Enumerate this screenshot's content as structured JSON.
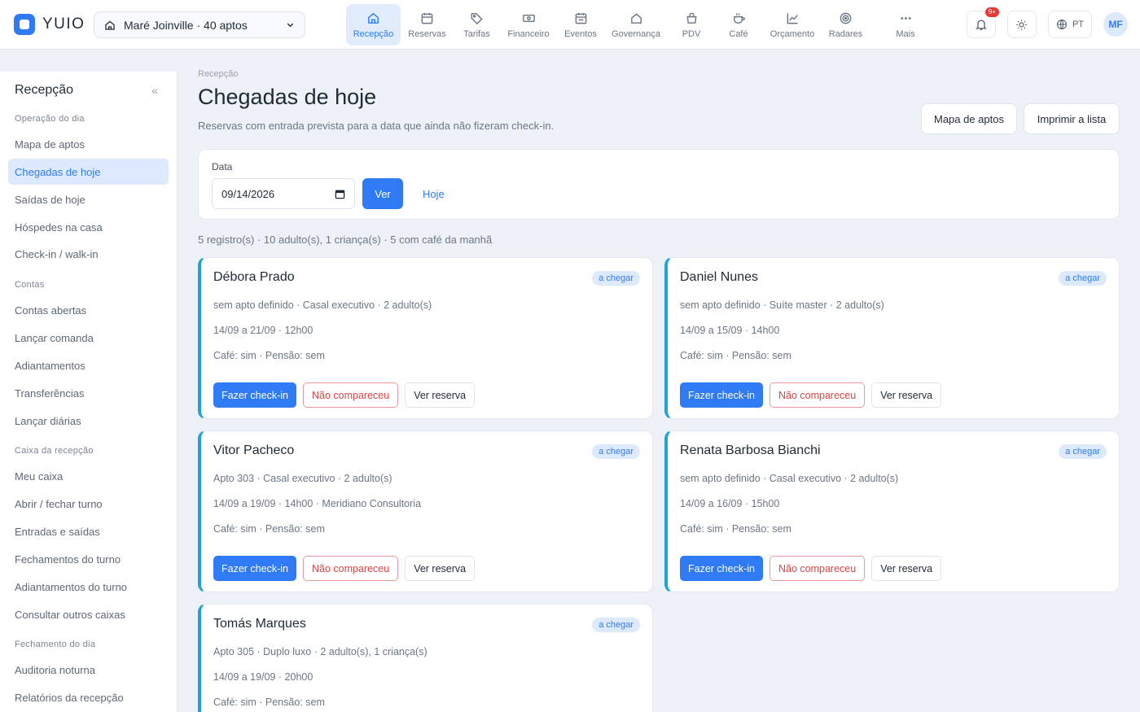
{
  "app": {
    "name": "YUIO"
  },
  "property": {
    "label": "Maré Joinville · 40 aptos"
  },
  "nav": [
    {
      "label": "Recepção",
      "icon": "home-icon",
      "active": true
    },
    {
      "label": "Reservas",
      "icon": "calendar-icon"
    },
    {
      "label": "Tarifas",
      "icon": "tag-icon"
    },
    {
      "label": "Financeiro",
      "icon": "money-icon"
    },
    {
      "label": "Eventos",
      "icon": "calendar-event-icon"
    },
    {
      "label": "Governança",
      "icon": "house-icon"
    },
    {
      "label": "PDV",
      "icon": "shopping-bag-icon"
    },
    {
      "label": "Café",
      "icon": "coffee-icon"
    },
    {
      "label": "Orçamento",
      "icon": "chart-line-icon"
    },
    {
      "label": "Radares",
      "icon": "target-icon"
    },
    {
      "label": "Mais",
      "icon": "more-icon"
    }
  ],
  "topbar": {
    "notifications_badge": "9+",
    "language": "PT",
    "user_initials": "MF"
  },
  "sidebar": {
    "title": "Recepção",
    "collapse_glyph": "«",
    "sections": [
      {
        "label": "Operação do dia",
        "items": [
          "Mapa de aptos",
          "Chegadas de hoje",
          "Saídas de hoje",
          "Hóspedes na casa",
          "Check-in / walk-in"
        ]
      },
      {
        "label": "Contas",
        "items": [
          "Contas abertas",
          "Lançar comanda",
          "Adiantamentos",
          "Transferências",
          "Lançar diárias"
        ]
      },
      {
        "label": "Caixa da recepção",
        "items": [
          "Meu caixa",
          "Abrir / fechar turno",
          "Entradas e saídas",
          "Fechamentos do turno",
          "Adiantamentos do turno",
          "Consultar outros caixas"
        ]
      },
      {
        "label": "Fechamento do dia",
        "items": [
          "Auditoria noturna",
          "Relatórios da recepção"
        ]
      }
    ],
    "active_item": "Chegadas de hoje"
  },
  "page": {
    "breadcrumb": "Recepção",
    "title": "Chegadas de hoje",
    "subtitle": "Reservas com entrada prevista para a data que ainda não fizeram check-in.",
    "buttons": {
      "map": "Mapa de aptos",
      "print": "Imprimir a lista"
    }
  },
  "filter": {
    "date_label": "Data",
    "date_value": "09/14/2026",
    "ver_label": "Ver",
    "hoje_label": "Hoje"
  },
  "summary": "5 registro(s) · 10 adulto(s), 1 criança(s) · 5 com café da manhã",
  "cards": [
    {
      "name": "Débora Prado",
      "status": "a chegar",
      "line1": "sem apto definido · Casal executivo · 2 adulto(s)",
      "line2": "14/09 a 21/09 · 12h00",
      "line3": "Café: sim · Pensão: sem"
    },
    {
      "name": "Daniel Nunes",
      "status": "a chegar",
      "line1": "sem apto definido · Suíte master · 2 adulto(s)",
      "line2": "14/09 a 15/09 · 14h00",
      "line3": "Café: sim · Pensão: sem"
    },
    {
      "name": "Vitor Pacheco",
      "status": "a chegar",
      "line1": "Apto 303 · Casal executivo · 2 adulto(s)",
      "line2": "14/09 a 19/09 · 14h00 · Meridiano Consultoria",
      "line3": "Café: sim · Pensão: sem"
    },
    {
      "name": "Renata Barbosa Bianchi",
      "status": "a chegar",
      "line1": "sem apto definido · Casal executivo · 2 adulto(s)",
      "line2": "14/09 a 16/09 · 15h00",
      "line3": "Café: sim · Pensão: sem"
    },
    {
      "name": "Tomás Marques",
      "status": "a chegar",
      "line1": "Apto 305 · Duplo luxo · 2 adulto(s), 1 criança(s)",
      "line2": "14/09 a 19/09 · 20h00",
      "line3": "Café: sim · Pensão: sem"
    }
  ],
  "card_actions": {
    "checkin": "Fazer check-in",
    "noshow": "Não compareceu",
    "view": "Ver reserva"
  },
  "colors": {
    "accent": "#2f7bf5",
    "card_stripe": "#20a4cf",
    "danger": "#e04444",
    "notification": "#e53935"
  }
}
